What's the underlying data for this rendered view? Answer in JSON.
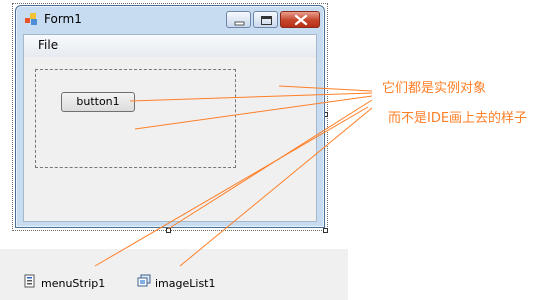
{
  "window": {
    "title": "Form1"
  },
  "menu": {
    "file": "File"
  },
  "form": {
    "button_label": "button1"
  },
  "tray": {
    "items": [
      {
        "label": "menuStrip1",
        "icon": "menu-strip-icon"
      },
      {
        "label": "imageList1",
        "icon": "image-list-icon"
      }
    ]
  },
  "annotations": {
    "line1": "它们都是实例对象",
    "line2": "而不是IDE画上去的样子"
  },
  "colors": {
    "annotation": "#ff7f27",
    "close_button": "#c5442a",
    "window_frame": "#c7dcf1"
  }
}
